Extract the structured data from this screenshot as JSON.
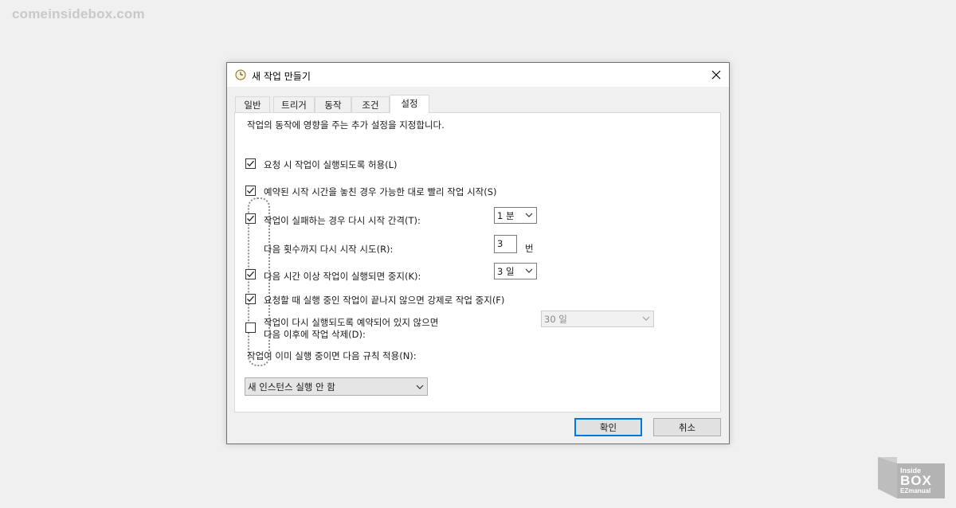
{
  "watermark": "comeinsidebox.com",
  "logo": {
    "line1": "Inside",
    "line2": "BOX",
    "line3": "EZmanual"
  },
  "dialog": {
    "title": "새 작업 만들기",
    "icon": "clock-icon",
    "close_icon": "close-icon"
  },
  "tabs": [
    {
      "label": "일반"
    },
    {
      "label": "트리거"
    },
    {
      "label": "동작"
    },
    {
      "label": "조건"
    },
    {
      "label": "설정",
      "active": true
    }
  ],
  "panel": {
    "description": "작업의 동작에 영향을 주는 추가 설정을 지정합니다.",
    "options": {
      "allow_demand": {
        "label": "요청 시 작업이 실행되도록 허용(L)",
        "checked": true
      },
      "run_missed": {
        "label": "예약된 시작 시간을 놓친 경우 가능한 대로 빨리 작업 시작(S)",
        "checked": true
      },
      "restart_on_fail": {
        "label": "작업이 실패하는 경우 다시 시작 간격(T):",
        "checked": true,
        "value": "1 분"
      },
      "restart_count": {
        "label": "다음 횟수까지 다시 시작 시도(R):",
        "value": "3",
        "unit": "번"
      },
      "stop_if_longer": {
        "label": "다음 시간 이상 작업이 실행되면 중지(K):",
        "checked": true,
        "value": "3 일"
      },
      "force_stop": {
        "label": "요청할 때 실행 중인 작업이 끝나지 않으면 강제로 작업 중지(F)",
        "checked": true
      },
      "delete_if_not_scheduled": {
        "label_line1": "작업이 다시 실행되도록 예약되어 있지 않으면",
        "label_line2": "다음 이후에 작업 삭제(D):",
        "checked": false,
        "value": "30 일"
      }
    },
    "rule_label": "작업이 이미 실행 중이면 다음 규칙 적용(N):",
    "rule_value": "새 인스턴스 실행 안 함"
  },
  "buttons": {
    "ok": "확인",
    "cancel": "취소"
  },
  "colors": {
    "accent": "#0078d7",
    "highlight_border": "#8c8c8c"
  }
}
